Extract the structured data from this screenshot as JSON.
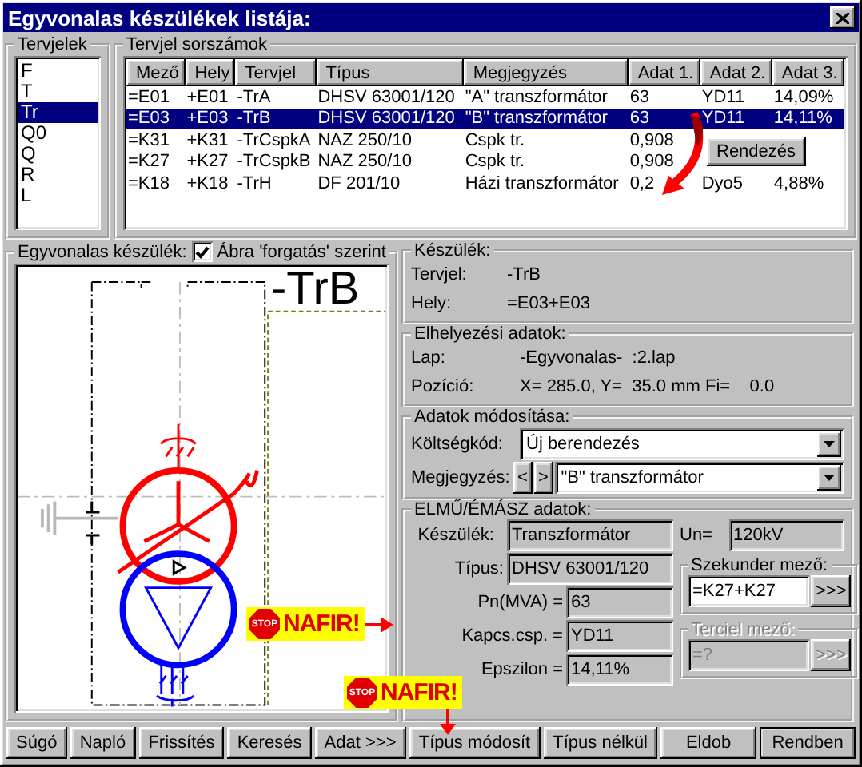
{
  "window": {
    "title": "Egyvonalas készülékek listája:"
  },
  "designators": {
    "label": "Tervjelek",
    "items": [
      {
        "text": "F",
        "selected": false
      },
      {
        "text": "T",
        "selected": false
      },
      {
        "text": "Tr",
        "selected": true
      },
      {
        "text": "Q0",
        "selected": false
      },
      {
        "text": "Q",
        "selected": false
      },
      {
        "text": "R",
        "selected": false
      },
      {
        "text": "L",
        "selected": false
      }
    ]
  },
  "numbers": {
    "label": "Tervjel sorszámok",
    "columns": [
      "Mező",
      "Hely",
      "Tervjel",
      "Típus",
      "Megjegyzés",
      "Adat 1.",
      "Adat 2.",
      "Adat 3."
    ],
    "rows": [
      {
        "cells": [
          "=E01",
          "+E01",
          "-TrA",
          "DHSV 63001/120",
          "\"A\" transzformátor",
          "63",
          "YD11",
          "14,09%"
        ],
        "selected": false
      },
      {
        "cells": [
          "=E03",
          "+E03",
          "-TrB",
          "DHSV 63001/120",
          "\"B\" transzformátor",
          "63",
          "YD11",
          "14,11%"
        ],
        "selected": true
      },
      {
        "cells": [
          "=K31",
          "+K31",
          "-TrCspkA",
          "NAZ 250/10",
          "Cspk tr.",
          "0,908"
        ],
        "selected": false
      },
      {
        "cells": [
          "=K27",
          "+K27",
          "-TrCspkB",
          "NAZ 250/10",
          "Cspk tr.",
          "0,908"
        ],
        "selected": false
      },
      {
        "cells": [
          "=K18",
          "+K18",
          "-TrH",
          "DF 201/10",
          "Házi transzformátor",
          "0,2",
          "Dyo5",
          "4,88%"
        ],
        "selected": false
      }
    ],
    "sort_button": "Rendezés"
  },
  "preview": {
    "label": "Egyvonalas készülék:",
    "rotate": {
      "label": "Ábra 'forgatás' szerint",
      "checked": true
    },
    "designator": "-TrB"
  },
  "device": {
    "label": "Készülék:",
    "fields": [
      {
        "label": "Tervjel:",
        "value": "-TrB"
      },
      {
        "label": "Hely:",
        "value": "=E03+E03"
      }
    ]
  },
  "placement": {
    "label": "Elhelyezési adatok:",
    "fields": [
      {
        "label": "Lap:",
        "value": "-Egyvonalas-  :2.lap"
      },
      {
        "label": "Pozíció:",
        "value": "X= 285.0, Y=  35.0 mm Fi=    0.0"
      }
    ]
  },
  "modify": {
    "label": "Adatok módosítása:",
    "cost": {
      "label": "Költségkód:",
      "value": "Új berendezés"
    },
    "note": {
      "label": "Megjegyzés:",
      "prev": "<",
      "next": ">",
      "value": "\"B\" transzformátor"
    }
  },
  "utility": {
    "label": "ELMŰ/ÉMÁSZ adatok:",
    "device": {
      "label": "Készülék:",
      "value": "Transzformátor"
    },
    "un": {
      "label": "Un=",
      "value": "120kV"
    },
    "type": {
      "label": "Típus:",
      "value": "DHSV 63001/120"
    },
    "params": [
      {
        "label": "Pn(MVA) =",
        "value": "63"
      },
      {
        "label": "Kapcs.csp. =",
        "value": "YD11"
      },
      {
        "label": "Epszilon =",
        "value": "14,11%"
      }
    ],
    "secondary": {
      "label": "Szekunder mező:",
      "value": "=K27+K27",
      "button": ">>>",
      "disabled": false
    },
    "tertiary": {
      "label": "Terciel mező:",
      "value": "=?",
      "button": ">>>",
      "disabled": true
    }
  },
  "badges": [
    {
      "sign": "STOP",
      "text": "NAFIR!"
    },
    {
      "sign": "STOP",
      "text": "NAFIR!"
    }
  ],
  "buttons": [
    {
      "label": "Súgó",
      "default": false
    },
    {
      "label": "Napló",
      "default": false
    },
    {
      "label": "Frissítés",
      "default": false
    },
    {
      "label": "Keresés",
      "default": false
    },
    {
      "label": "Adat >>>",
      "default": false
    },
    {
      "label": "Típus módosít",
      "default": false
    },
    {
      "label": "Típus nélkül",
      "default": false
    },
    {
      "label": "Eldob",
      "default": false
    },
    {
      "label": "Rendben",
      "default": true
    }
  ]
}
